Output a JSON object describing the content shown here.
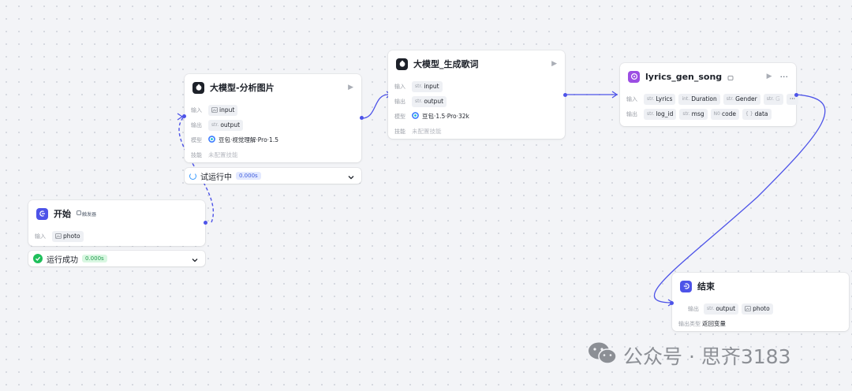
{
  "nodes": {
    "analyze_image": {
      "title": "大模型-分析图片",
      "input_label": "输入",
      "input_tag": "input",
      "output_label": "输出",
      "output_type": "str.",
      "output_tag": "output",
      "model_label": "模型",
      "model_name": "豆包·视觉理解·Pro·1.5",
      "skill_label": "技能",
      "skill_value": "未配置技能"
    },
    "gen_lyrics": {
      "title": "大模型_生成歌词",
      "input_label": "输入",
      "input_type": "str.",
      "input_tag": "input",
      "output_label": "输出",
      "output_type": "str.",
      "output_tag": "output",
      "model_label": "模型",
      "model_name": "豆包·1.5·Pro·32k",
      "skill_label": "技能",
      "skill_value": "未配置技能"
    },
    "lyrics_gen_song": {
      "title": "lyrics_gen_song",
      "input_label": "输入",
      "inputs": [
        {
          "type": "str.",
          "name": "Lyrics"
        },
        {
          "type": "int.",
          "name": "Duration"
        },
        {
          "type": "str.",
          "name": "Gender"
        },
        {
          "type": "str.",
          "name": "G"
        }
      ],
      "more": "···",
      "output_label": "输出",
      "outputs": [
        {
          "type": "str.",
          "name": "log_id"
        },
        {
          "type": "str.",
          "name": "msg"
        },
        {
          "type": "N0",
          "name": "code"
        },
        {
          "type": "{ }",
          "name": "data"
        }
      ]
    },
    "start": {
      "title": "开始",
      "trigger": "触发器",
      "input_label": "输入",
      "input_tag": "photo"
    },
    "end": {
      "title": "结束",
      "output_label": "输出",
      "output_type": "str.",
      "output_tag": "output",
      "output_tag2": "photo",
      "output_kind_label": "输出类型",
      "output_kind_value": "返回变量"
    }
  },
  "run_status": {
    "running": {
      "text": "试运行中",
      "time": "0.000s"
    },
    "success": {
      "text": "运行成功",
      "time": "0.000s"
    }
  },
  "watermark": {
    "text": "公众号 · 思齐3183"
  },
  "colors": {
    "accent": "#4d53e8",
    "edge": "#4d53e8",
    "success": "#1fbf5b"
  }
}
